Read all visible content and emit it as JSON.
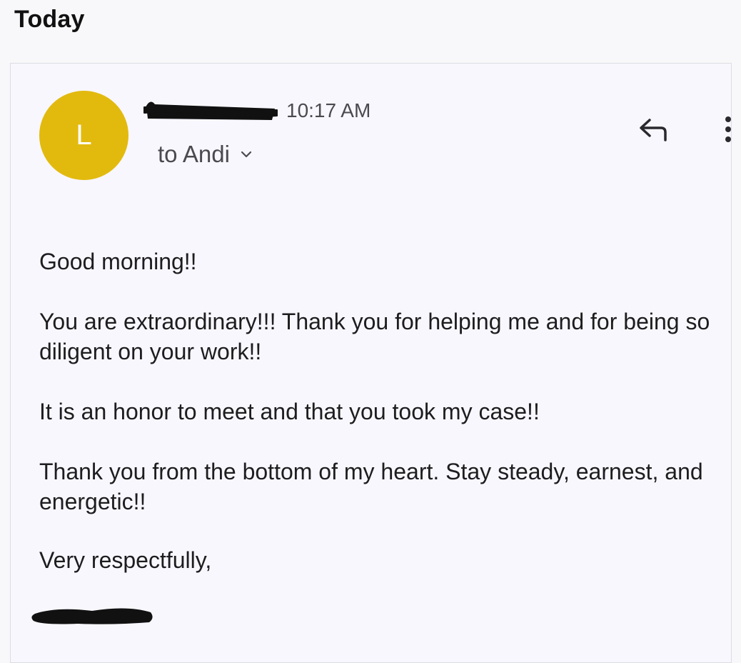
{
  "section_header": "Today",
  "email": {
    "avatar_letter": "L",
    "timestamp": "10:17 AM",
    "recipient": "to Andi",
    "body": {
      "greeting": "Good morning!!",
      "paragraph_1": "You are extraordinary!!! Thank you for helping me and for being so diligent on your work!!",
      "paragraph_2": "It is an honor to meet and that you took my case!!",
      "paragraph_3": "Thank you from the bottom of my heart. Stay steady, earnest, and energetic!!",
      "closing": "Very respectfully,"
    }
  },
  "colors": {
    "avatar": "#e2ba0e",
    "card_background": "#f8f7fd",
    "redaction": "#111111"
  },
  "icons": {
    "reply": "reply-arrow-icon",
    "more": "more-vertical-icon",
    "expand": "chevron-down-icon"
  }
}
